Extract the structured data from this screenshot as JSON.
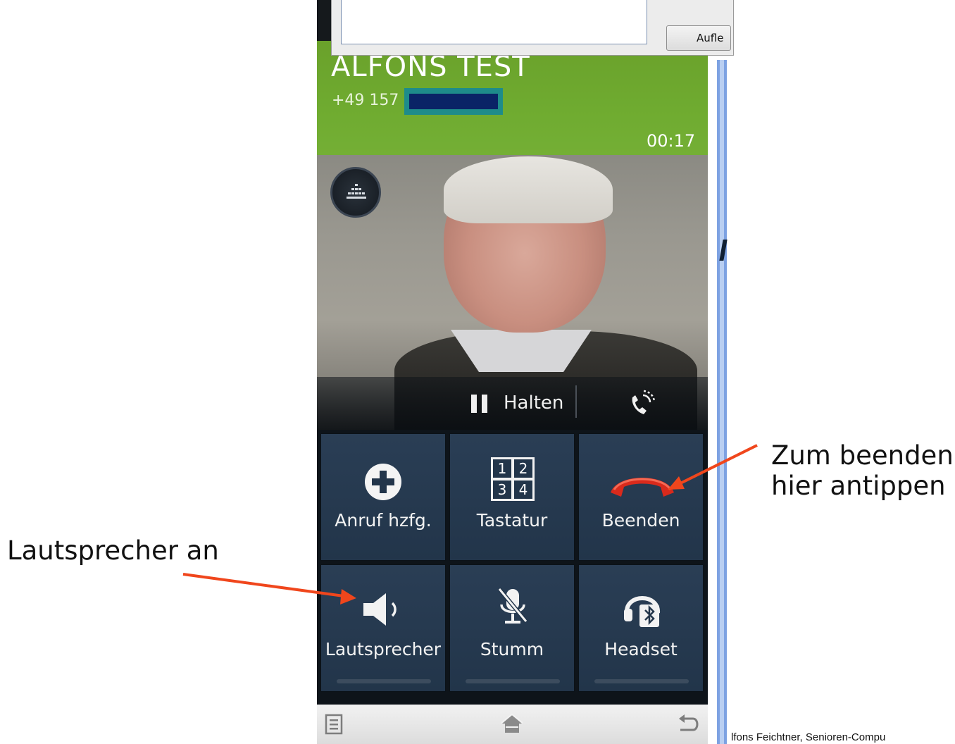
{
  "dialog": {
    "button_label": "Aufle"
  },
  "call": {
    "caller_name": "ALFONS TEST",
    "caller_number_prefix": "+49 157",
    "timer": "00:17",
    "header_color": "#6aa12b"
  },
  "hold_bar": {
    "hold_label": "Halten"
  },
  "buttons": [
    {
      "label": "Anruf hzfg.",
      "icon": "add-call-icon"
    },
    {
      "label": "Tastatur",
      "icon": "keypad-icon",
      "keys": [
        "1",
        "2",
        "3",
        "4"
      ]
    },
    {
      "label": "Beenden",
      "icon": "end-call-icon",
      "color": "#d92a1c"
    },
    {
      "label": "Lautsprecher",
      "icon": "speaker-icon"
    },
    {
      "label": "Stumm",
      "icon": "mic-muted-icon"
    },
    {
      "label": "Headset",
      "icon": "bluetooth-headset-icon"
    }
  ],
  "nav": {
    "icons": [
      "menu-icon",
      "home-icon",
      "back-icon"
    ]
  },
  "annotations": {
    "end_call_line1": "Zum beenden",
    "end_call_line2": "hier antippen",
    "speaker": "Lautsprecher an",
    "arrow_color": "#f0461c"
  },
  "footer": {
    "text": "lfons Feichtner, Senioren-Compu"
  }
}
